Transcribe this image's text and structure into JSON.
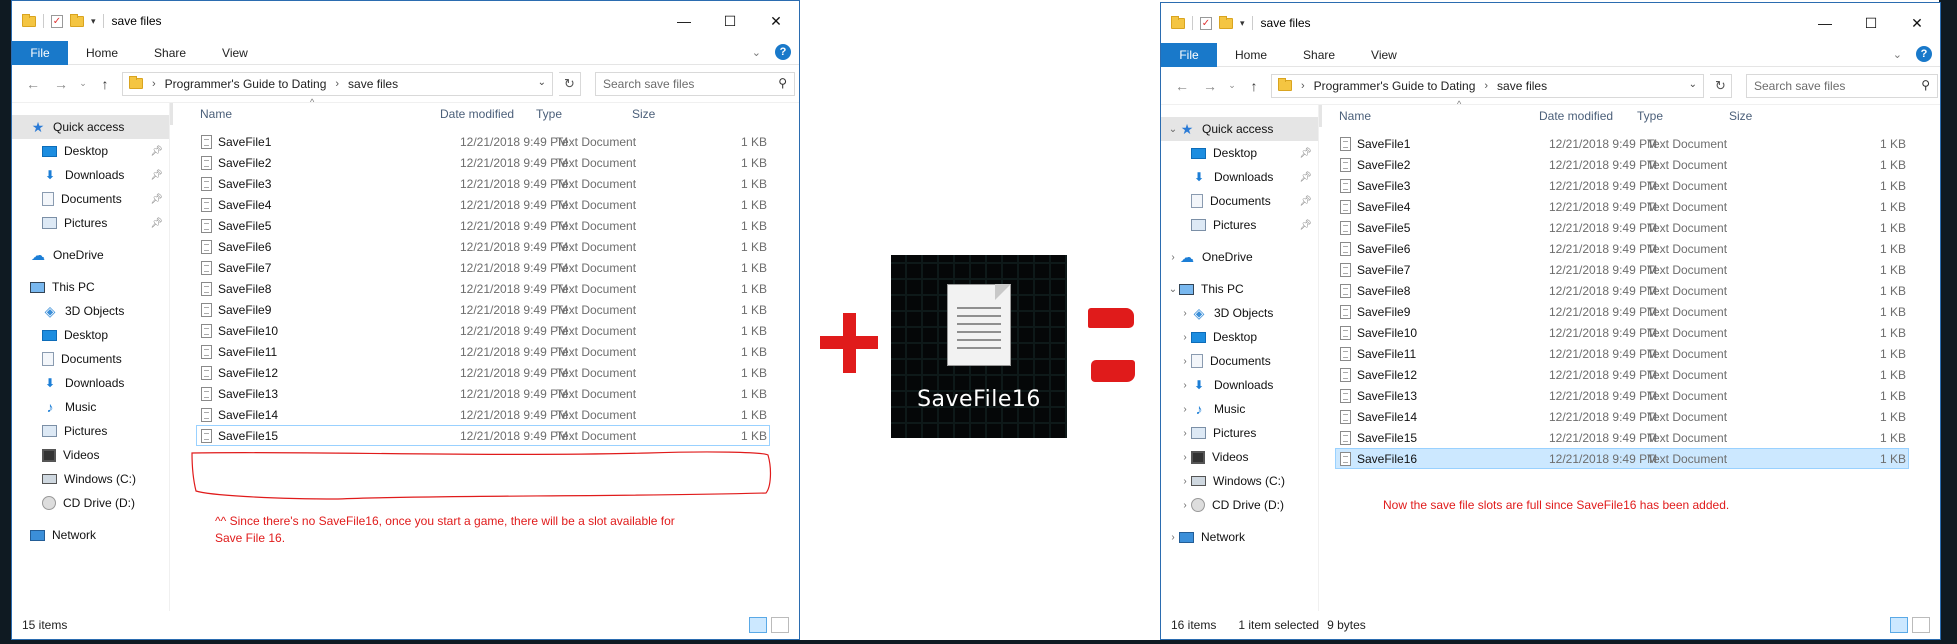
{
  "left_window": {
    "title": "save files",
    "ribbon_tabs": [
      "File",
      "Home",
      "Share",
      "View"
    ],
    "path": [
      "Programmer's Guide to Dating",
      "save files"
    ],
    "search_placeholder": "Search save files",
    "nav": {
      "quick_access": "Quick access",
      "quick_items": [
        "Desktop",
        "Downloads",
        "Documents",
        "Pictures"
      ],
      "onedrive": "OneDrive",
      "this_pc": "This PC",
      "pc_items": [
        "3D Objects",
        "Desktop",
        "Documents",
        "Downloads",
        "Music",
        "Pictures",
        "Videos",
        "Windows (C:)",
        "CD Drive (D:)"
      ],
      "network": "Network"
    },
    "columns": [
      "Name",
      "Date modified",
      "Type",
      "Size"
    ],
    "files": [
      {
        "name": "SaveFile1",
        "date": "12/21/2018 9:49 PM",
        "type": "Text Document",
        "size": "1 KB"
      },
      {
        "name": "SaveFile2",
        "date": "12/21/2018 9:49 PM",
        "type": "Text Document",
        "size": "1 KB"
      },
      {
        "name": "SaveFile3",
        "date": "12/21/2018 9:49 PM",
        "type": "Text Document",
        "size": "1 KB"
      },
      {
        "name": "SaveFile4",
        "date": "12/21/2018 9:49 PM",
        "type": "Text Document",
        "size": "1 KB"
      },
      {
        "name": "SaveFile5",
        "date": "12/21/2018 9:49 PM",
        "type": "Text Document",
        "size": "1 KB"
      },
      {
        "name": "SaveFile6",
        "date": "12/21/2018 9:49 PM",
        "type": "Text Document",
        "size": "1 KB"
      },
      {
        "name": "SaveFile7",
        "date": "12/21/2018 9:49 PM",
        "type": "Text Document",
        "size": "1 KB"
      },
      {
        "name": "SaveFile8",
        "date": "12/21/2018 9:49 PM",
        "type": "Text Document",
        "size": "1 KB"
      },
      {
        "name": "SaveFile9",
        "date": "12/21/2018 9:49 PM",
        "type": "Text Document",
        "size": "1 KB"
      },
      {
        "name": "SaveFile10",
        "date": "12/21/2018 9:49 PM",
        "type": "Text Document",
        "size": "1 KB"
      },
      {
        "name": "SaveFile11",
        "date": "12/21/2018 9:49 PM",
        "type": "Text Document",
        "size": "1 KB"
      },
      {
        "name": "SaveFile12",
        "date": "12/21/2018 9:49 PM",
        "type": "Text Document",
        "size": "1 KB"
      },
      {
        "name": "SaveFile13",
        "date": "12/21/2018 9:49 PM",
        "type": "Text Document",
        "size": "1 KB"
      },
      {
        "name": "SaveFile14",
        "date": "12/21/2018 9:49 PM",
        "type": "Text Document",
        "size": "1 KB"
      },
      {
        "name": "SaveFile15",
        "date": "12/21/2018 9:49 PM",
        "type": "Text Document",
        "size": "1 KB"
      }
    ],
    "annotation": "^^ Since there's no SaveFile16, once you start a game, there will be a slot available for Save File 16.",
    "status": {
      "items": "15 items"
    }
  },
  "game_tile": {
    "label": "SaveFile16"
  },
  "right_window": {
    "title": "save files",
    "ribbon_tabs": [
      "File",
      "Home",
      "Share",
      "View"
    ],
    "path": [
      "Programmer's Guide to Dating",
      "save files"
    ],
    "search_placeholder": "Search save files",
    "nav": {
      "quick_access": "Quick access",
      "quick_items": [
        "Desktop",
        "Downloads",
        "Documents",
        "Pictures"
      ],
      "onedrive": "OneDrive",
      "this_pc": "This PC",
      "pc_items": [
        "3D Objects",
        "Desktop",
        "Documents",
        "Downloads",
        "Music",
        "Pictures",
        "Videos",
        "Windows (C:)",
        "CD Drive (D:)"
      ],
      "network": "Network"
    },
    "columns": [
      "Name",
      "Date modified",
      "Type",
      "Size"
    ],
    "files": [
      {
        "name": "SaveFile1",
        "date": "12/21/2018 9:49 PM",
        "type": "Text Document",
        "size": "1 KB"
      },
      {
        "name": "SaveFile2",
        "date": "12/21/2018 9:49 PM",
        "type": "Text Document",
        "size": "1 KB"
      },
      {
        "name": "SaveFile3",
        "date": "12/21/2018 9:49 PM",
        "type": "Text Document",
        "size": "1 KB"
      },
      {
        "name": "SaveFile4",
        "date": "12/21/2018 9:49 PM",
        "type": "Text Document",
        "size": "1 KB"
      },
      {
        "name": "SaveFile5",
        "date": "12/21/2018 9:49 PM",
        "type": "Text Document",
        "size": "1 KB"
      },
      {
        "name": "SaveFile6",
        "date": "12/21/2018 9:49 PM",
        "type": "Text Document",
        "size": "1 KB"
      },
      {
        "name": "SaveFile7",
        "date": "12/21/2018 9:49 PM",
        "type": "Text Document",
        "size": "1 KB"
      },
      {
        "name": "SaveFile8",
        "date": "12/21/2018 9:49 PM",
        "type": "Text Document",
        "size": "1 KB"
      },
      {
        "name": "SaveFile9",
        "date": "12/21/2018 9:49 PM",
        "type": "Text Document",
        "size": "1 KB"
      },
      {
        "name": "SaveFile10",
        "date": "12/21/2018 9:49 PM",
        "type": "Text Document",
        "size": "1 KB"
      },
      {
        "name": "SaveFile11",
        "date": "12/21/2018 9:49 PM",
        "type": "Text Document",
        "size": "1 KB"
      },
      {
        "name": "SaveFile12",
        "date": "12/21/2018 9:49 PM",
        "type": "Text Document",
        "size": "1 KB"
      },
      {
        "name": "SaveFile13",
        "date": "12/21/2018 9:49 PM",
        "type": "Text Document",
        "size": "1 KB"
      },
      {
        "name": "SaveFile14",
        "date": "12/21/2018 9:49 PM",
        "type": "Text Document",
        "size": "1 KB"
      },
      {
        "name": "SaveFile15",
        "date": "12/21/2018 9:49 PM",
        "type": "Text Document",
        "size": "1 KB"
      },
      {
        "name": "SaveFile16",
        "date": "12/21/2018 9:49 PM",
        "type": "Text Document",
        "size": "1 KB"
      }
    ],
    "annotation": "Now the save file slots are full since SaveFile16 has been added.",
    "status": {
      "items": "16 items",
      "selected": "1 item selected",
      "size": "9 bytes"
    }
  },
  "colors": {
    "accent": "#1979ca",
    "annotation": "#e01b1b",
    "selection": "#cce8ff"
  }
}
